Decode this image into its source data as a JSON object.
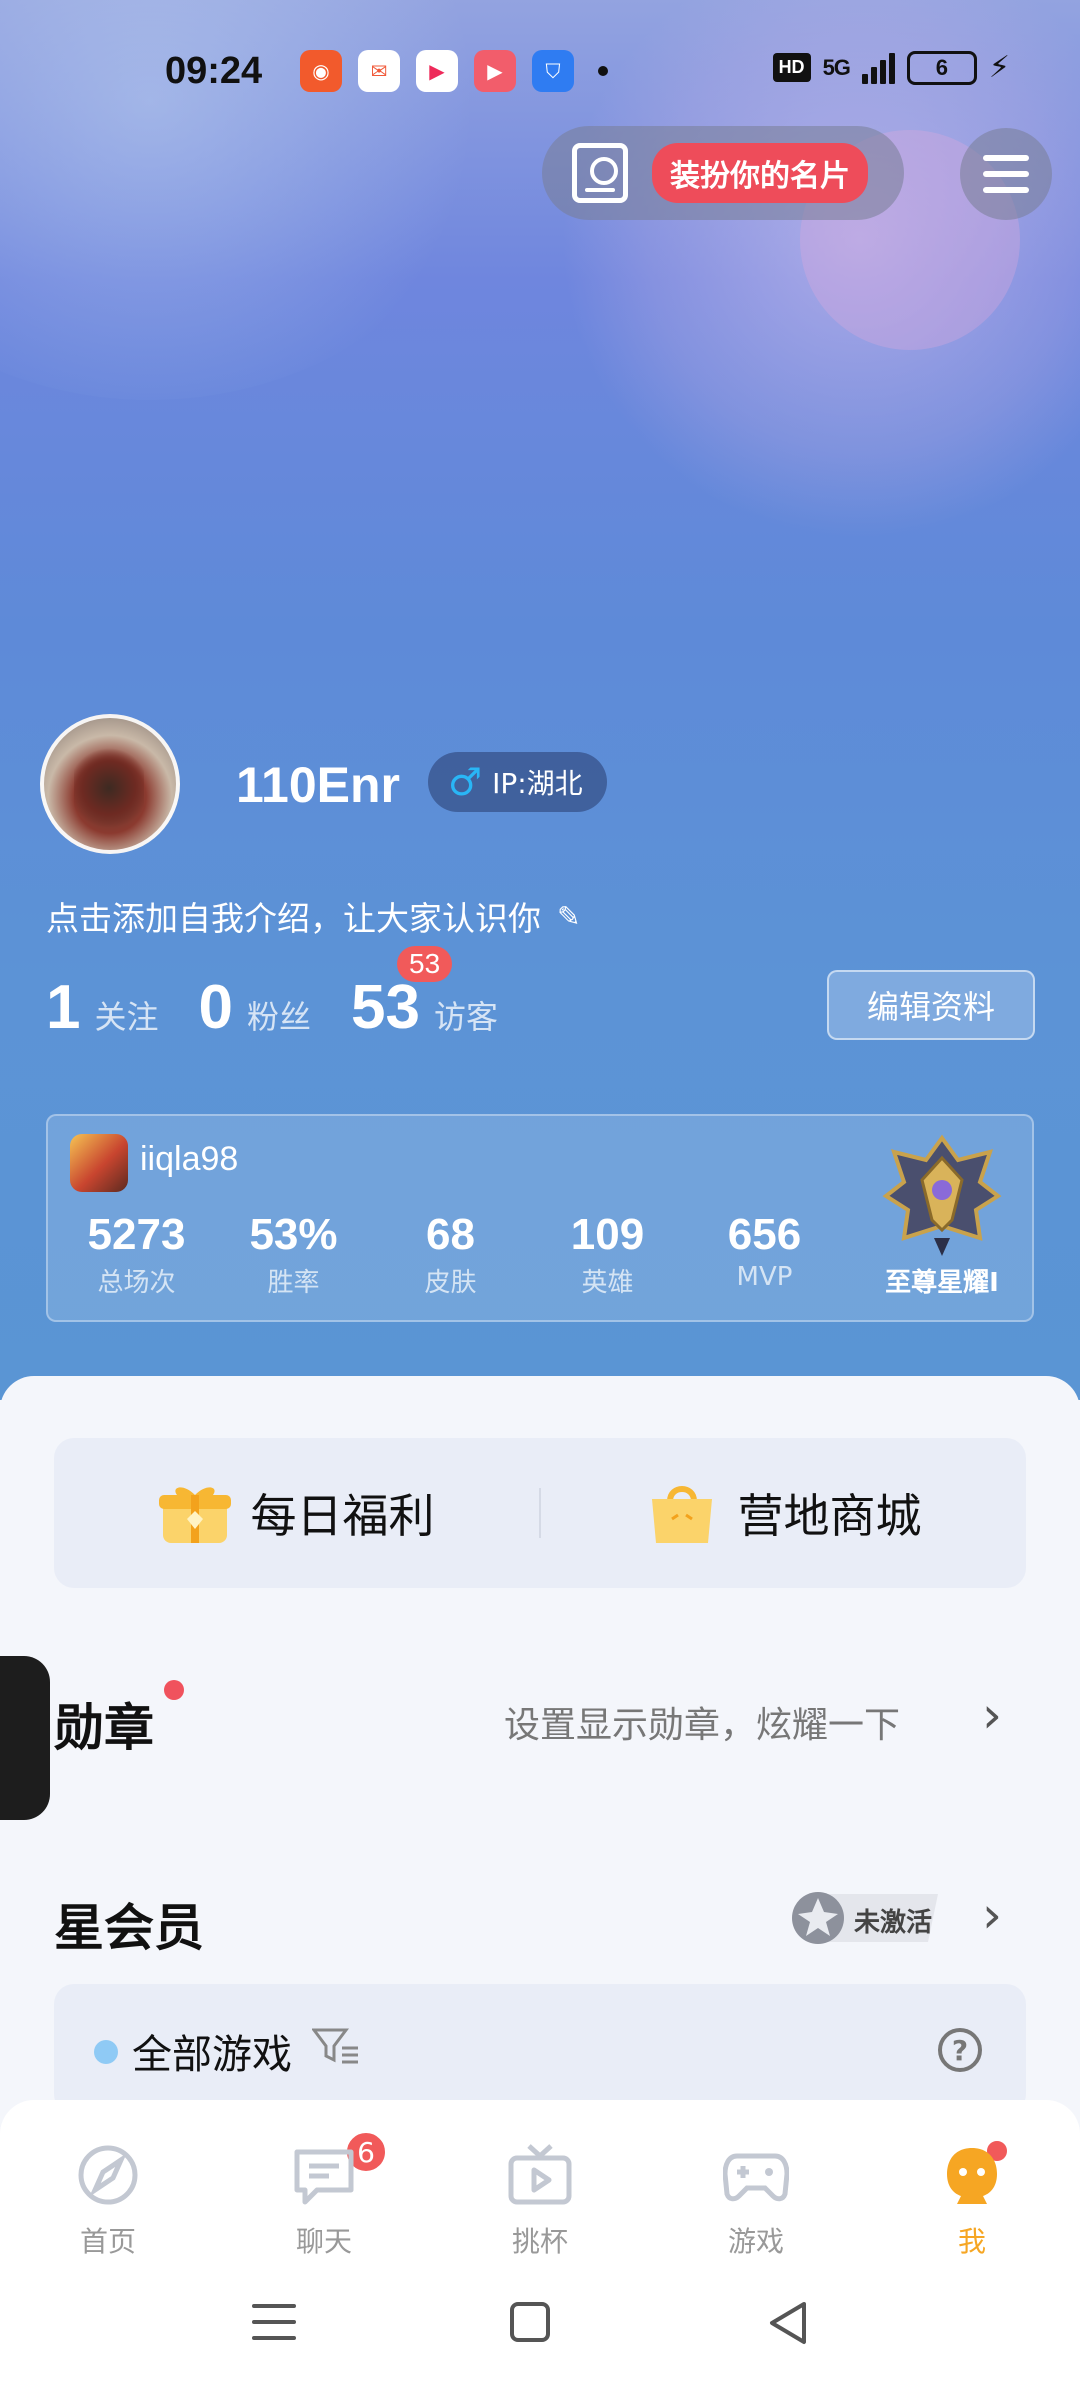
{
  "status_bar": {
    "time": "09:24",
    "network": "5G",
    "hd_label": "HD",
    "battery": "6"
  },
  "header": {
    "card_button_label": "装扮你的名片"
  },
  "profile": {
    "username": "110Enr",
    "ip_label": "IP:湖北",
    "intro_placeholder": "点击添加自我介绍，让大家认识你",
    "stats": [
      {
        "value": "1",
        "label": "关注"
      },
      {
        "value": "0",
        "label": "粉丝"
      },
      {
        "value": "53",
        "label": "访客",
        "badge": "53"
      }
    ],
    "edit_button": "编辑资料"
  },
  "game_card": {
    "account": "iiqla98",
    "stats": [
      {
        "value": "5273",
        "label": "总场次"
      },
      {
        "value": "53%",
        "label": "胜率"
      },
      {
        "value": "68",
        "label": "皮肤"
      },
      {
        "value": "109",
        "label": "英雄"
      },
      {
        "value": "656",
        "label": "MVP"
      }
    ],
    "rank": "至尊星耀I"
  },
  "welfare": {
    "daily": "每日福利",
    "store": "营地商城"
  },
  "medals": {
    "title": "勋章",
    "hint": "设置显示勋章，炫耀一下"
  },
  "membership": {
    "title": "星会员",
    "status": "未激活"
  },
  "games_filter": {
    "label": "全部游戏"
  },
  "bottom_nav": [
    {
      "label": "首页"
    },
    {
      "label": "聊天",
      "badge": "6"
    },
    {
      "label": "挑杯"
    },
    {
      "label": "游戏"
    },
    {
      "label": "我"
    }
  ],
  "colors": {
    "accent_red": "#ee4c5a",
    "active_nav": "#f6a623",
    "male_icon": "#29b6f6"
  }
}
